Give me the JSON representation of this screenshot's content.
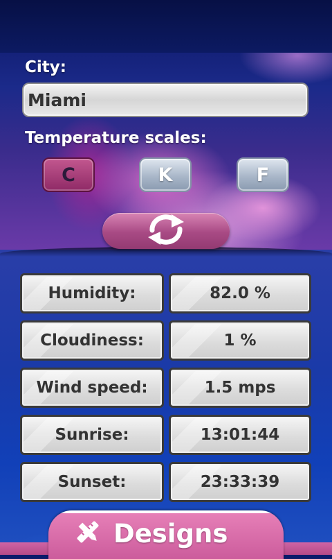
{
  "city": {
    "label": "City:",
    "value": "Miami"
  },
  "scales": {
    "label": "Temperature scales:",
    "buttons": [
      {
        "label": "C",
        "selected": true
      },
      {
        "label": "K",
        "selected": false
      },
      {
        "label": "F",
        "selected": false
      }
    ]
  },
  "refresh": {
    "icon": "refresh-icon"
  },
  "weather": [
    {
      "label": "Humidity:",
      "value": "82.0 %"
    },
    {
      "label": "Cloudiness:",
      "value": "1 %"
    },
    {
      "label": "Wind speed:",
      "value": "1.5 mps"
    },
    {
      "label": "Sunrise:",
      "value": "13:01:44"
    },
    {
      "label": "Sunset:",
      "value": "23:33:39"
    }
  ],
  "designs": {
    "label": "Designs",
    "icon": "pencil-ruler-icon"
  },
  "colors": {
    "selected_scale": "#8f2a66",
    "accent_pink": "#cc5c9c",
    "unselected_scale": "#a9b7c9"
  }
}
